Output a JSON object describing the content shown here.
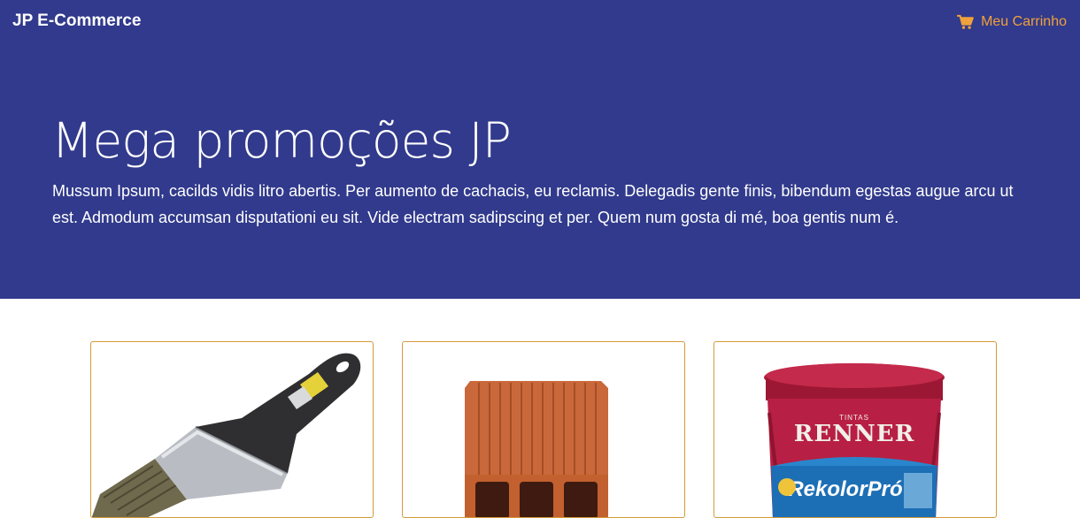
{
  "navbar": {
    "brand": "JP E-Commerce",
    "cart_label": "Meu Carrinho",
    "cart_icon": "shopping-cart-icon"
  },
  "hero": {
    "title": "Mega promoções JP",
    "text": "Mussum Ipsum, cacilds vidis litro abertis. Per aumento de cachacis, eu reclamis. Delegadis gente finis, bibendum egestas augue arcu ut est. Admodum accumsan disputationi eu sit. Vide electram sadipscing et per. Quem num gosta di mé, boa gentis num é."
  },
  "products": {
    "paint_brand": "RENNER",
    "paint_tintas": "TINTAS",
    "paint_product": "RekolorPró"
  },
  "colors": {
    "hero_bg": "#313a8c",
    "accent": "#f0a13b",
    "card_border": "#d49a3a"
  }
}
